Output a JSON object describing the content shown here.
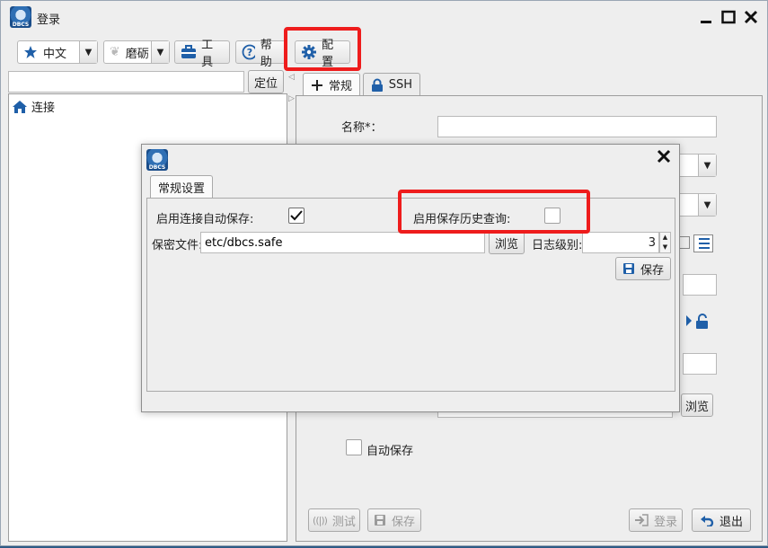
{
  "window": {
    "title": "登录",
    "logo_text": "DBCS"
  },
  "toolbar": {
    "language": "中文",
    "theme": "磨砺",
    "tools_label": "工具",
    "help_label": "帮助",
    "config_label": "配置"
  },
  "left": {
    "locate_label": "定位",
    "search_value": "",
    "tree_root": "连接"
  },
  "right": {
    "tabs": [
      {
        "label": "常规"
      },
      {
        "label": "SSH"
      }
    ],
    "name_label": "名称*：",
    "name_value": "",
    "browse_label": "浏览",
    "autosave_label": "自动保存"
  },
  "bottom": {
    "test_label": "测试",
    "save_label": "保存",
    "login_label": "登录",
    "exit_label": "退出"
  },
  "dialog": {
    "logo_text": "DBCS",
    "tab_label": "常规设置",
    "auto_save_label": "启用连接自动保存:",
    "auto_save_checked": true,
    "history_label": "启用保存历史查询:",
    "history_checked": false,
    "secret_file_label": "保密文件:",
    "secret_file_value": "etc/dbcs.safe",
    "browse_label": "浏览",
    "log_level_label": "日志级别:",
    "log_level_value": "3",
    "save_label": "保存"
  },
  "colors": {
    "highlight": "#ee1c1c",
    "accent_blue": "#1f5fa8"
  }
}
